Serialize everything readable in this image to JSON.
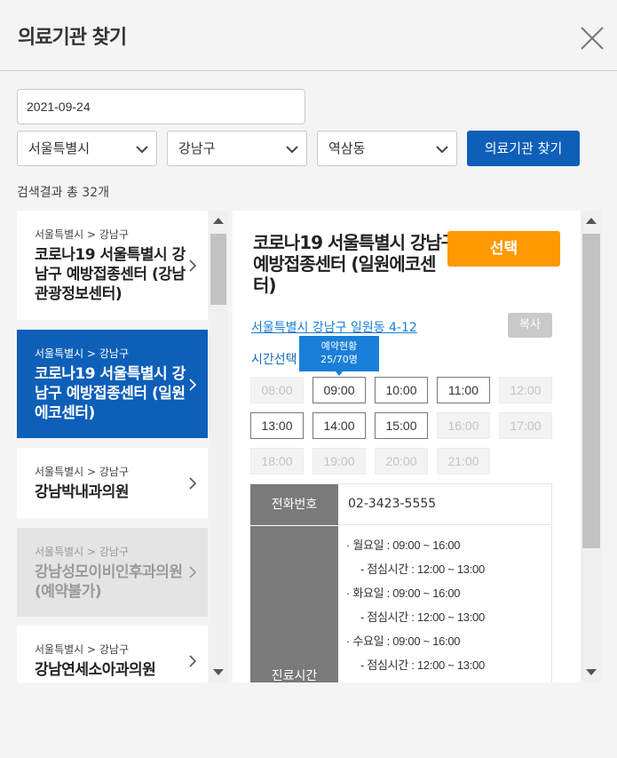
{
  "modal": {
    "title": "의료기관 찾기"
  },
  "filters": {
    "date": "2021-09-24",
    "city": "서울특별시",
    "district": "강남구",
    "dong": "역삼동",
    "search_label": "의료기관 찾기"
  },
  "result_count": "검색결과 총 32개",
  "list": [
    {
      "region": "서울특별시 > 강남구",
      "name": "코로나19 서울특별시 강남구 예방접종센터 (강남관광정보센터)",
      "state": "normal"
    },
    {
      "region": "서울특별시 > 강남구",
      "name": "코로나19 서울특별시 강남구 예방접종센터 (일원에코센터)",
      "state": "active"
    },
    {
      "region": "서울특별시 > 강남구",
      "name": "강남박내과의원",
      "state": "normal"
    },
    {
      "region": "서울특별시 > 강남구",
      "name": "강남성모이비인후과의원 (예약불가)",
      "state": "disabled"
    },
    {
      "region": "서울특별시 > 강남구",
      "name": "강남연세소아과의원",
      "state": "normal"
    }
  ],
  "detail": {
    "title": "코로나19 서울특별시 강남구 예방접종센터 (일원에코센터)",
    "select_label": "선택",
    "address": "서울특별시 강남구 일원동 4-12",
    "copy_label": "복사",
    "time_label": "시간선택",
    "tooltip_title": "예약현황",
    "tooltip_value": "25/70명",
    "slots": [
      {
        "time": "08:00",
        "available": false
      },
      {
        "time": "09:00",
        "available": true
      },
      {
        "time": "10:00",
        "available": true
      },
      {
        "time": "11:00",
        "available": true
      },
      {
        "time": "12:00",
        "available": false
      },
      {
        "time": "13:00",
        "available": true
      },
      {
        "time": "14:00",
        "available": true
      },
      {
        "time": "15:00",
        "available": true
      },
      {
        "time": "16:00",
        "available": false
      },
      {
        "time": "17:00",
        "available": false
      },
      {
        "time": "18:00",
        "available": false
      },
      {
        "time": "19:00",
        "available": false
      },
      {
        "time": "20:00",
        "available": false
      },
      {
        "time": "21:00",
        "available": false
      }
    ],
    "phone_header": "전화번호",
    "phone": "02-3423-5555",
    "hours_header": "진료시간",
    "hours": [
      {
        "text": "· 월요일 : 09:00 ~ 16:00",
        "sub": false
      },
      {
        "text": "- 점심시간 : 12:00 ~ 13:00",
        "sub": true
      },
      {
        "text": "· 화요일 : 09:00 ~ 16:00",
        "sub": false
      },
      {
        "text": "- 점심시간 : 12:00 ~ 13:00",
        "sub": true
      },
      {
        "text": "· 수요일 : 09:00 ~ 16:00",
        "sub": false
      },
      {
        "text": "- 점심시간 : 12:00 ~ 13:00",
        "sub": true
      }
    ]
  }
}
